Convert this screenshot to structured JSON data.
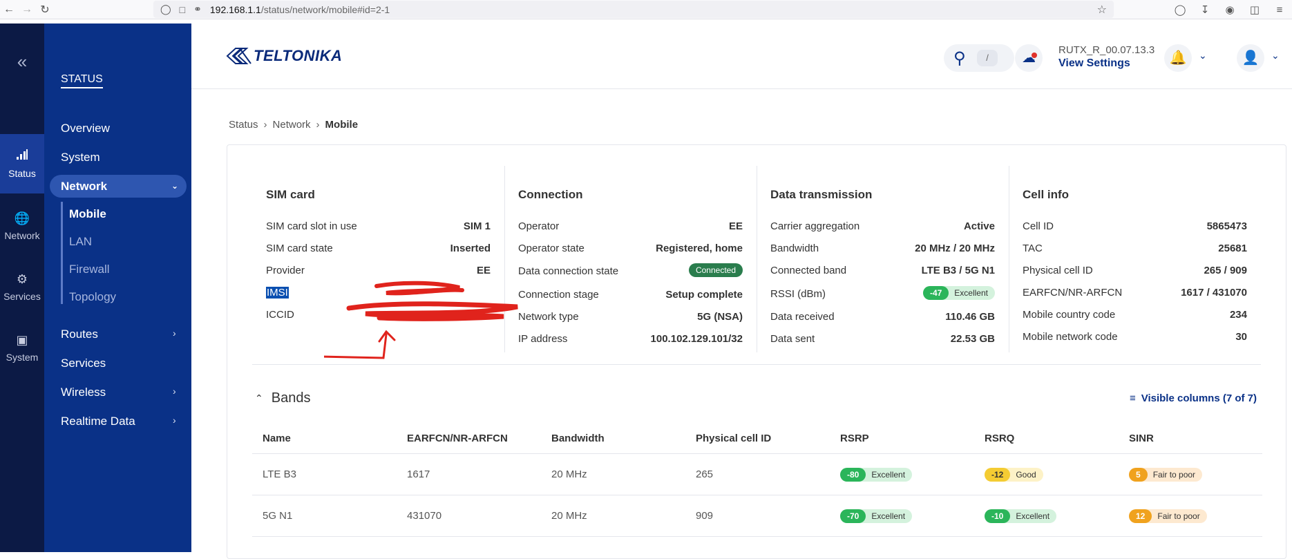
{
  "browser": {
    "url_host": "192.168.1.1",
    "url_path": "/status/network/mobile#id=2-1"
  },
  "rail": {
    "items": [
      {
        "label": "Status",
        "icon": "signal-icon"
      },
      {
        "label": "Network",
        "icon": "globe-icon"
      },
      {
        "label": "Services",
        "icon": "gear-icon"
      },
      {
        "label": "System",
        "icon": "system-icon"
      }
    ]
  },
  "sidenav": {
    "section_title": "STATUS",
    "items": {
      "overview": "Overview",
      "system": "System",
      "network": "Network",
      "mobile": "Mobile",
      "lan": "LAN",
      "firewall": "Firewall",
      "topology": "Topology",
      "routes": "Routes",
      "services": "Services",
      "wireless": "Wireless",
      "realtime": "Realtime Data"
    }
  },
  "header": {
    "brand": "TELTONIKA",
    "search_shortcut": "/",
    "firmware_version": "RUTX_R_00.07.13.3",
    "view_settings": "View Settings"
  },
  "breadcrumb": {
    "items": [
      "Status",
      "Network",
      "Mobile"
    ]
  },
  "sim_card": {
    "title": "SIM card",
    "rows": [
      {
        "key": "SIM card slot in use",
        "value": "SIM 1"
      },
      {
        "key": "SIM card state",
        "value": "Inserted"
      },
      {
        "key": "Provider",
        "value": "EE"
      },
      {
        "key": "IMSI",
        "value": ""
      },
      {
        "key": "ICCID",
        "value": ""
      }
    ]
  },
  "connection": {
    "title": "Connection",
    "rows": [
      {
        "key": "Operator",
        "value": "EE"
      },
      {
        "key": "Operator state",
        "value": "Registered, home"
      },
      {
        "key": "Data connection state",
        "value": "Connected"
      },
      {
        "key": "Connection stage",
        "value": "Setup complete"
      },
      {
        "key": "Network type",
        "value": "5G (NSA)"
      },
      {
        "key": "IP address",
        "value": "100.102.129.101/32"
      }
    ]
  },
  "data_transmission": {
    "title": "Data transmission",
    "rows": [
      {
        "key": "Carrier aggregation",
        "value": "Active"
      },
      {
        "key": "Bandwidth",
        "value": "20 MHz / 20 MHz"
      },
      {
        "key": "Connected band",
        "value": "LTE B3 / 5G N1"
      },
      {
        "key": "RSSI (dBm)",
        "value": "-47",
        "quality": "Excellent"
      },
      {
        "key": "Data received",
        "value": "110.46 GB"
      },
      {
        "key": "Data sent",
        "value": "22.53 GB"
      }
    ]
  },
  "cell_info": {
    "title": "Cell info",
    "rows": [
      {
        "key": "Cell ID",
        "value": "5865473"
      },
      {
        "key": "TAC",
        "value": "25681"
      },
      {
        "key": "Physical cell ID",
        "value": "265 / 909"
      },
      {
        "key": "EARFCN/NR-ARFCN",
        "value": "1617 / 431070"
      },
      {
        "key": "Mobile country code",
        "value": "234"
      },
      {
        "key": "Mobile network code",
        "value": "30"
      }
    ]
  },
  "bands": {
    "title": "Bands",
    "visible_columns": "Visible columns (7 of 7)",
    "columns": [
      "Name",
      "EARFCN/NR-ARFCN",
      "Bandwidth",
      "Physical cell ID",
      "RSRP",
      "RSRQ",
      "SINR"
    ],
    "rows": [
      {
        "name": "LTE B3",
        "earfcn": "1617",
        "bandwidth": "20 MHz",
        "pci": "265",
        "rsrp": "-80",
        "rsrp_q": "Excellent",
        "rsrq": "-12",
        "rsrq_q": "Good",
        "sinr": "5",
        "sinr_q": "Fair to poor"
      },
      {
        "name": "5G N1",
        "earfcn": "431070",
        "bandwidth": "20 MHz",
        "pci": "909",
        "rsrp": "-70",
        "rsrp_q": "Excellent",
        "rsrq": "-10",
        "rsrq_q": "Excellent",
        "sinr": "12",
        "sinr_q": "Fair to poor"
      }
    ]
  },
  "colors": {
    "rail_bg": "#0c1a45",
    "sidenav_bg": "#0a3187",
    "accent": "#0a3187",
    "excellent": "#2bb55a",
    "good": "#f4cc33",
    "fair": "#f0a21e",
    "redaction": "#e0231c"
  }
}
